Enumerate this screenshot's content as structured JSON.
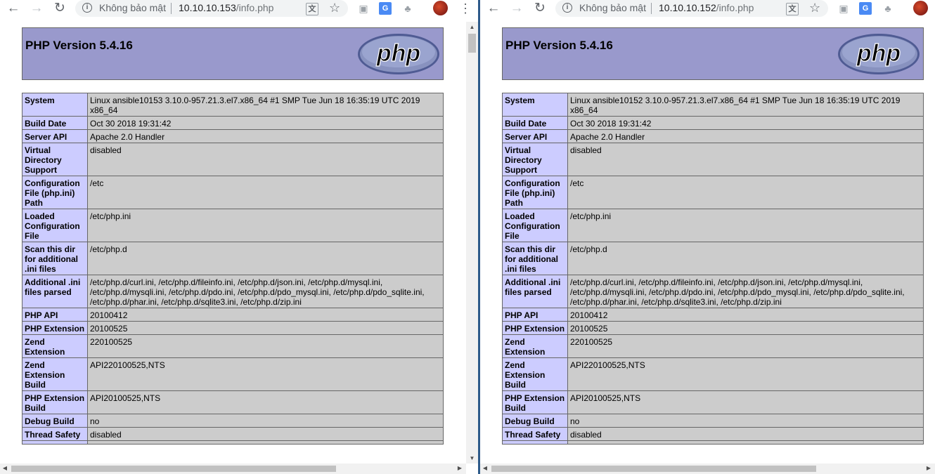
{
  "browser": {
    "back_glyph": "←",
    "forward_glyph": "→",
    "reload_glyph": "↻",
    "info_glyph": "i",
    "star_glyph": "☆",
    "menu_glyph": "⋮",
    "translate_glyph": "文",
    "gt_glyph": "G",
    "camera_glyph": "▣",
    "tree_glyph": "♣",
    "icons": [
      "back-icon",
      "forward-icon",
      "reload-icon",
      "info-icon",
      "translate-icon",
      "star-icon",
      "camera-icon",
      "google-translate-icon",
      "sitemap-icon",
      "avatar",
      "menu-icon"
    ],
    "secure_label": "Không bảo mật"
  },
  "left": {
    "url_host": "10.10.10.153",
    "url_path": "/info.php",
    "title": "PHP Version 5.4.16",
    "rows": [
      {
        "k": "System",
        "v": "Linux ansible10153 3.10.0-957.21.3.el7.x86_64 #1 SMP Tue Jun 18 16:35:19 UTC 2019 x86_64"
      },
      {
        "k": "Build Date",
        "v": "Oct 30 2018 19:31:42"
      },
      {
        "k": "Server API",
        "v": "Apache 2.0 Handler"
      },
      {
        "k": "Virtual Directory Support",
        "v": "disabled"
      },
      {
        "k": "Configuration File (php.ini) Path",
        "v": "/etc"
      },
      {
        "k": "Loaded Configuration File",
        "v": "/etc/php.ini"
      },
      {
        "k": "Scan this dir for additional .ini files",
        "v": "/etc/php.d"
      },
      {
        "k": "Additional .ini files parsed",
        "v": "/etc/php.d/curl.ini, /etc/php.d/fileinfo.ini, /etc/php.d/json.ini, /etc/php.d/mysql.ini, /etc/php.d/mysqli.ini, /etc/php.d/pdo.ini, /etc/php.d/pdo_mysql.ini, /etc/php.d/pdo_sqlite.ini, /etc/php.d/phar.ini, /etc/php.d/sqlite3.ini, /etc/php.d/zip.ini"
      },
      {
        "k": "PHP API",
        "v": "20100412"
      },
      {
        "k": "PHP Extension",
        "v": "20100525"
      },
      {
        "k": "Zend Extension",
        "v": "220100525"
      },
      {
        "k": "Zend Extension Build",
        "v": "API220100525,NTS"
      },
      {
        "k": "PHP Extension Build",
        "v": "API20100525,NTS"
      },
      {
        "k": "Debug Build",
        "v": "no"
      },
      {
        "k": "Thread Safety",
        "v": "disabled"
      },
      {
        "k": "",
        "v": ""
      }
    ]
  },
  "right": {
    "url_host": "10.10.10.152",
    "url_path": "/info.php",
    "title": "PHP Version 5.4.16",
    "rows": [
      {
        "k": "System",
        "v": "Linux ansible10152 3.10.0-957.21.3.el7.x86_64 #1 SMP Tue Jun 18 16:35:19 UTC 2019 x86_64"
      },
      {
        "k": "Build Date",
        "v": "Oct 30 2018 19:31:42"
      },
      {
        "k": "Server API",
        "v": "Apache 2.0 Handler"
      },
      {
        "k": "Virtual Directory Support",
        "v": "disabled"
      },
      {
        "k": "Configuration File (php.ini) Path",
        "v": "/etc"
      },
      {
        "k": "Loaded Configuration File",
        "v": "/etc/php.ini"
      },
      {
        "k": "Scan this dir for additional .ini files",
        "v": "/etc/php.d"
      },
      {
        "k": "Additional .ini files parsed",
        "v": "/etc/php.d/curl.ini, /etc/php.d/fileinfo.ini, /etc/php.d/json.ini, /etc/php.d/mysql.ini, /etc/php.d/mysqli.ini, /etc/php.d/pdo.ini, /etc/php.d/pdo_mysql.ini, /etc/php.d/pdo_sqlite.ini, /etc/php.d/phar.ini, /etc/php.d/sqlite3.ini, /etc/php.d/zip.ini"
      },
      {
        "k": "PHP API",
        "v": "20100412"
      },
      {
        "k": "PHP Extension",
        "v": "20100525"
      },
      {
        "k": "Zend Extension",
        "v": "220100525"
      },
      {
        "k": "Zend Extension Build",
        "v": "API220100525,NTS"
      },
      {
        "k": "PHP Extension Build",
        "v": "API20100525,NTS"
      },
      {
        "k": "Debug Build",
        "v": "no"
      },
      {
        "k": "Thread Safety",
        "v": "disabled"
      },
      {
        "k": "",
        "v": ""
      }
    ]
  },
  "logo_text": "php",
  "colors": {
    "header_bg": "#9999cc",
    "key_bg": "#ccccff",
    "value_bg": "#cccccc",
    "logo_fill": "#6c7eb7",
    "divider": "#2d5a8a"
  }
}
